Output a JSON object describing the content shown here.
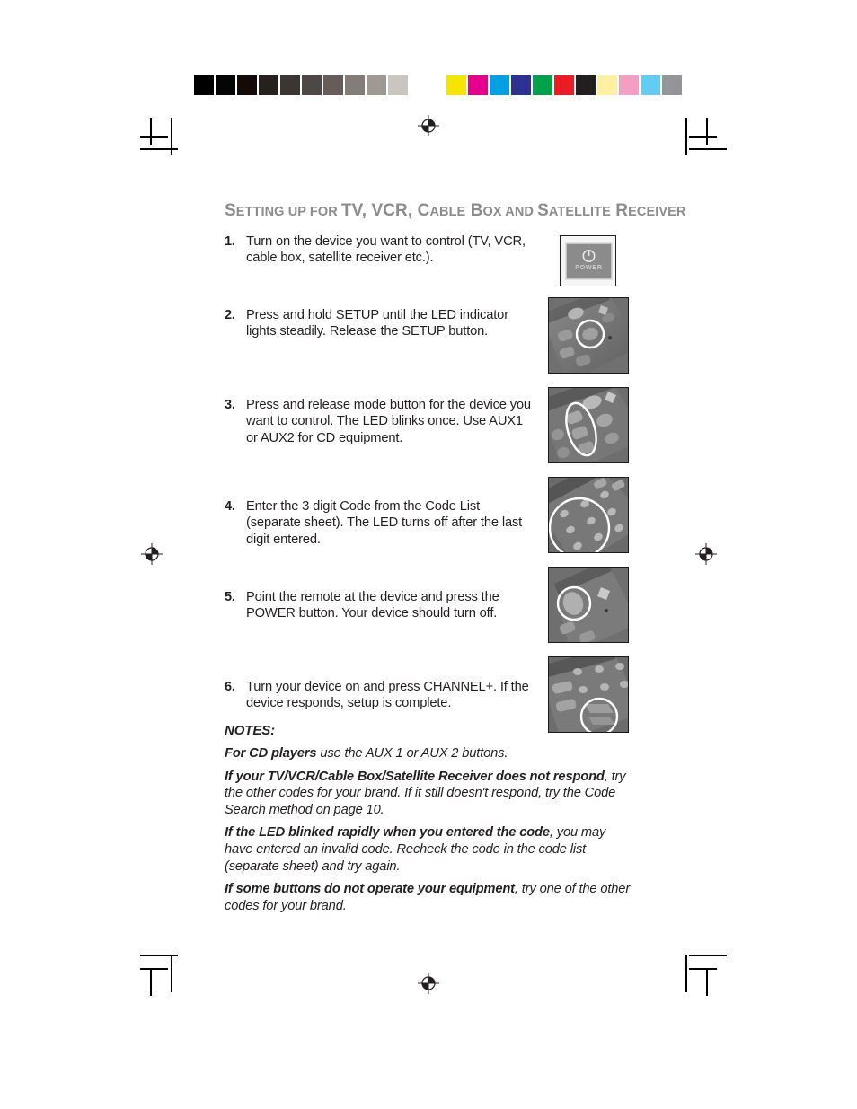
{
  "calibration": {
    "gray_bar": [
      "#000000",
      "#050505",
      "#120b07",
      "#26211f",
      "#3b3533",
      "#4d4745",
      "#645d59",
      "#837d79",
      "#9e9993",
      "#c9c6c1",
      "#ffffff"
    ],
    "color_bar": [
      "#f6e500",
      "#e5008c",
      "#00a0e3",
      "#2e3192",
      "#00a14b",
      "#ed1c24",
      "#231f20",
      "#fdf0a0",
      "#f59ec4",
      "#63cdf1",
      "#939598"
    ]
  },
  "page": {
    "section_heading": {
      "parts": [
        {
          "cap": "S",
          "rest": "ETTING"
        },
        {
          "cap": "",
          "rest": " "
        },
        {
          "cap": "",
          "rest": "UP"
        },
        {
          "cap": "",
          "rest": " FOR "
        },
        {
          "cap": "TV, VCR,",
          "rest": ""
        },
        {
          "cap": " C",
          "rest": "ABLE"
        },
        {
          "cap": " B",
          "rest": "OX"
        },
        {
          "cap": "",
          "rest": " AND "
        },
        {
          "cap": "S",
          "rest": "ATELLITE"
        },
        {
          "cap": " R",
          "rest": "ECEIVER"
        }
      ],
      "plain_text": "Setting up for TV, VCR, Cable Box and Satellite Receiver"
    },
    "steps": [
      {
        "number": "1.",
        "text": "Turn on the device you want to control (TV, VCR, cable box, satellite receiver etc.).",
        "image_name": "power-button-closeup-photo",
        "image_caption": "POWER"
      },
      {
        "number": "2.",
        "text": "Press and hold SETUP until the LED indicator lights steadily. Release the SETUP button.",
        "image_name": "remote-setup-button-photo",
        "image_caption": ""
      },
      {
        "number": "3.",
        "text": "Press and release mode button for the device you want to control. The LED blinks once. Use AUX1 or AUX2 for CD equipment.",
        "image_name": "remote-mode-buttons-photo",
        "image_caption": ""
      },
      {
        "number": "4.",
        "text": "Enter the 3 digit Code from the Code List (separate sheet). The LED turns off after the last digit entered.",
        "image_name": "remote-keypad-photo",
        "image_caption": ""
      },
      {
        "number": "5.",
        "text": "Point the remote at the device and press the POWER button. Your device should turn off.",
        "image_name": "remote-power-button-photo",
        "image_caption": ""
      },
      {
        "number": "6.",
        "text": "Turn your device on and press CHANNEL+. If the device responds, setup is complete.",
        "image_name": "remote-channel-up-button-photo",
        "image_caption": ""
      }
    ],
    "notes": {
      "title": "NOTES:",
      "items": [
        {
          "bold": "For CD players",
          "rest": " use the AUX 1 or AUX 2 buttons."
        },
        {
          "bold": "If your TV/VCR/Cable Box/Satellite Receiver does not respond",
          "rest": ", try the other codes for your brand. If it still doesn't respond, try the Code Search method on page 10."
        },
        {
          "bold": "If the LED blinked rapidly when you entered the code",
          "rest": ", you may have entered an invalid code. Recheck the code in the code list (separate sheet) and try again."
        },
        {
          "bold": "If some buttons do not operate your equipment",
          "rest": ", try one of the other codes for your brand."
        }
      ]
    }
  },
  "colors": {
    "heading_gray": "#8c8c8c",
    "body_black": "#231f20",
    "photo_frame": "#1a1a1a"
  }
}
